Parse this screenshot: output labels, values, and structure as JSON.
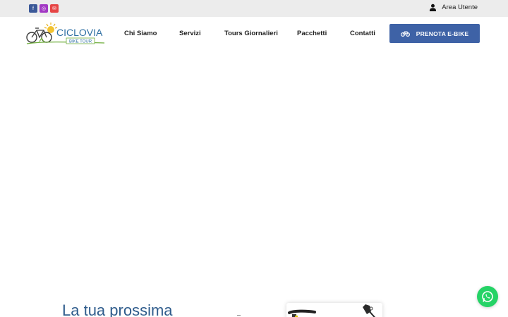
{
  "topbar": {
    "social": [
      {
        "name": "facebook-icon",
        "glyph": "f"
      },
      {
        "name": "instagram-icon",
        "glyph": "◎"
      },
      {
        "name": "mail-icon",
        "glyph": "✉"
      }
    ],
    "area_label": "Area Utente"
  },
  "logo": {
    "word": "CICLOVIA",
    "sub": "BIKE TOUR"
  },
  "nav": {
    "items": [
      "Chi Siamo",
      "Servizi",
      "Tours Giornalieri",
      "Pacchetti",
      "Contatti"
    ]
  },
  "cta": {
    "label": "PRENOTA E-BIKE"
  },
  "hero": {
    "headline": "La tua prossima"
  },
  "colors": {
    "accent": "#3e62a6",
    "topbar_bg": "#ececec",
    "headline": "#2f5c8c",
    "whatsapp": "#25d366"
  }
}
